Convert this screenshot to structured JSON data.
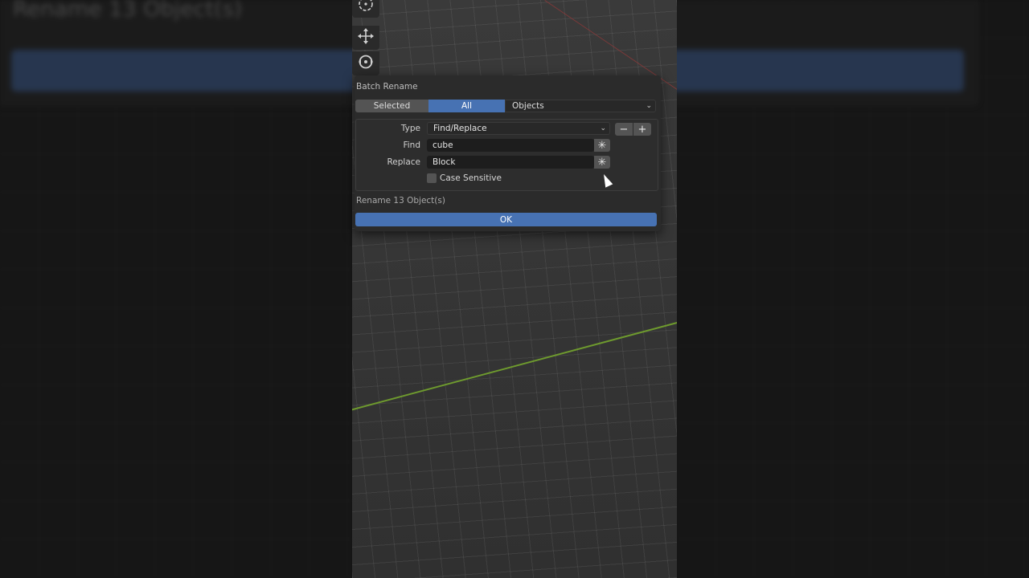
{
  "background": {
    "title": "Rename 13 Object(s)"
  },
  "tools": {
    "top_icon": "cursor-icon",
    "move_icon": "move-icon",
    "rotate_icon": "rotate-icon"
  },
  "dialog": {
    "title": "Batch Rename",
    "scope": {
      "selected_label": "Selected",
      "all_label": "All",
      "type_value": "Objects"
    },
    "type_label": "Type",
    "type_value": "Find/Replace",
    "find_label": "Find",
    "find_value": "cube",
    "replace_label": "Replace",
    "replace_value": "Block",
    "case_label": "Case Sensitive",
    "case_checked": false,
    "rename_info": "Rename 13 Object(s)",
    "ok_label": "OK"
  },
  "colors": {
    "accent": "#4772b3",
    "panel": "#2b2b2b",
    "axis_green": "#6e9a2e"
  }
}
